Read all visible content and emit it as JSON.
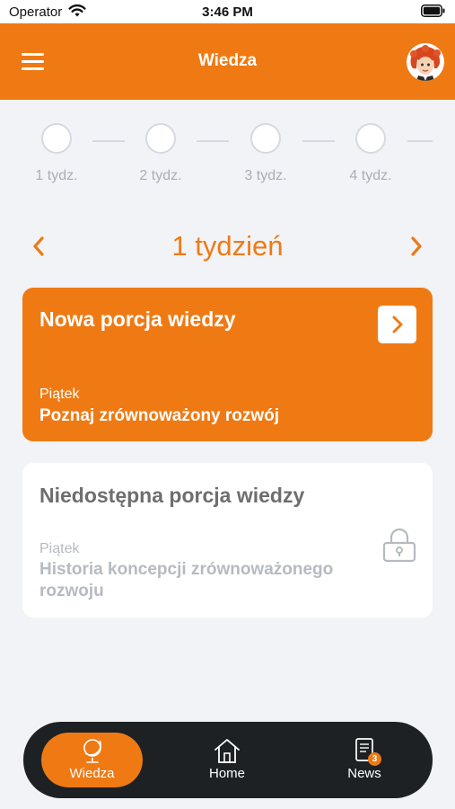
{
  "status_bar": {
    "carrier": "Operator",
    "time": "3:46 PM"
  },
  "header": {
    "title": "Wiedza"
  },
  "steps": [
    {
      "label": "1 tydz."
    },
    {
      "label": "2 tydz."
    },
    {
      "label": "3 tydz."
    },
    {
      "label": "4 tydz."
    }
  ],
  "week_nav": {
    "prev_icon": "chevron-left-icon",
    "title": "1 tydzień",
    "next_icon": "chevron-right-icon"
  },
  "cards": [
    {
      "title": "Nowa porcja wiedzy",
      "day": "Piątek",
      "topic": "Poznaj zrównoważony rozwój",
      "state": "available"
    },
    {
      "title": "Niedostępna porcja wiedzy",
      "day": "Piątek",
      "topic": "Historia koncepcji zrównoważonego rozwoju",
      "state": "locked"
    }
  ],
  "tabs": [
    {
      "label": "Wiedza",
      "icon": "globe-icon",
      "active": true
    },
    {
      "label": "Home",
      "icon": "house-icon",
      "active": false
    },
    {
      "label": "News",
      "icon": "news-icon",
      "active": false,
      "badge": "3"
    }
  ],
  "colors": {
    "accent": "#ef7a14",
    "background": "#f1f3f7",
    "tabbar": "#1d2124",
    "muted": "#b6bac1"
  }
}
